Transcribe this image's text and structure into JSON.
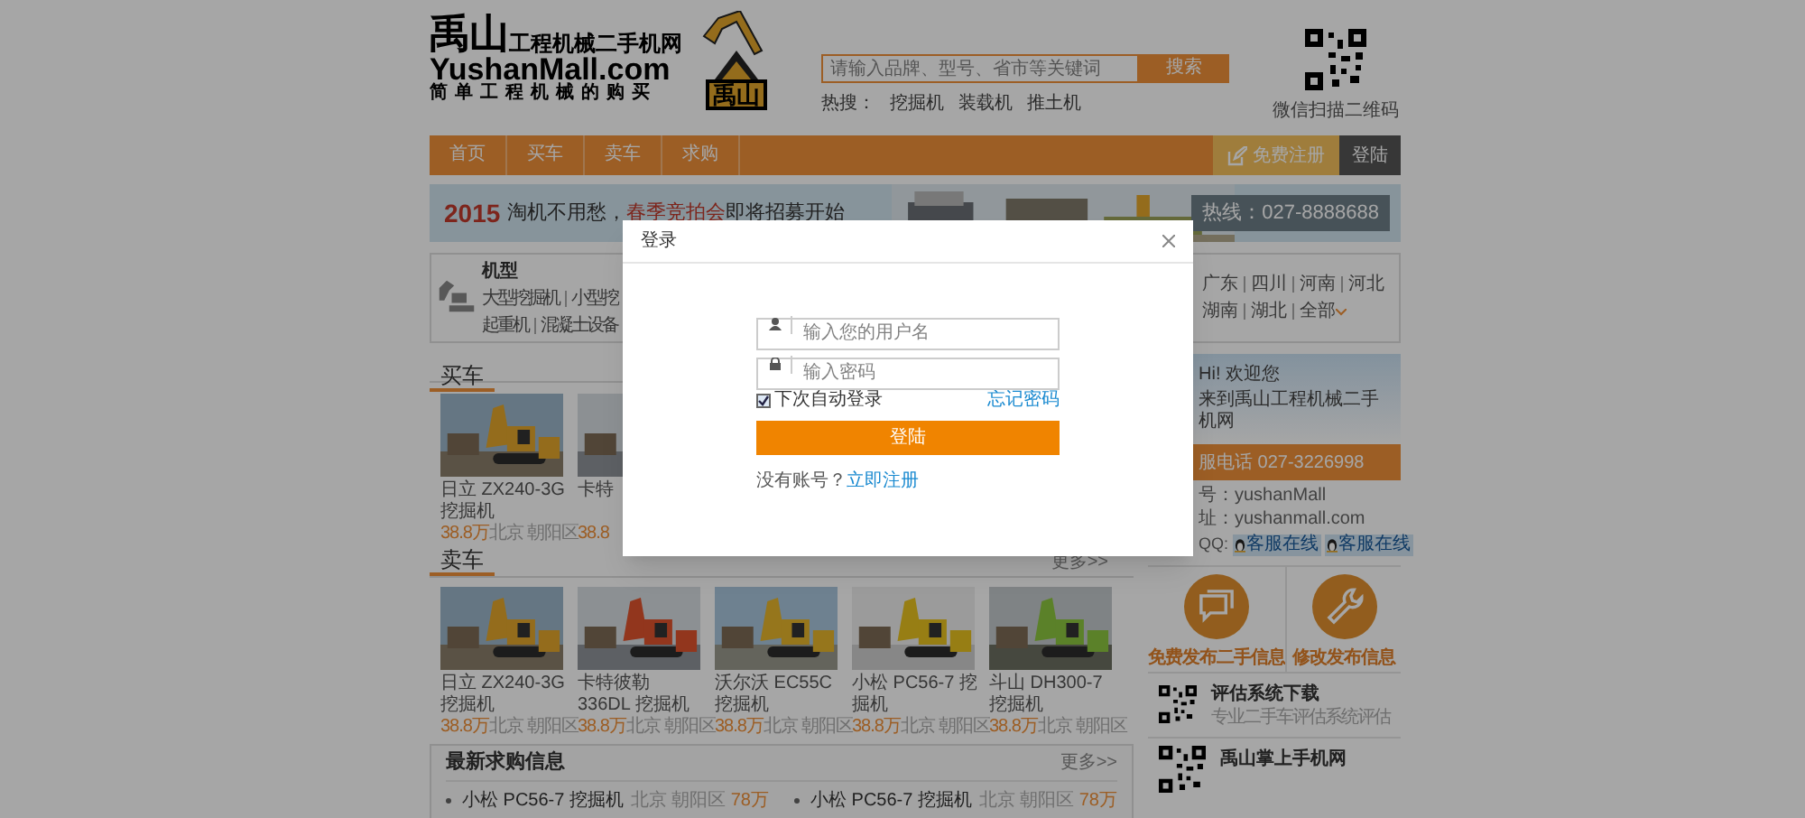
{
  "header": {
    "logo_brand": "禹山",
    "logo_name": "工程机械二手机网",
    "logo_domain": "YushanMall.com",
    "logo_slogan": "简单工程机械的购买",
    "logo_badge": "禹山",
    "search": {
      "placeholder": "请输入品牌、型号、省市等关键词",
      "button": "搜索"
    },
    "hot_label": "热搜：",
    "hot_terms": [
      "挖掘机",
      "装载机",
      "推土机"
    ],
    "qr_caption": "微信扫描二维码"
  },
  "nav": {
    "items": [
      "首页",
      "买车",
      "卖车",
      "求购"
    ],
    "register": "免费注册",
    "login": "登陆"
  },
  "banner": {
    "year": "2015",
    "text": "淘机不用愁，",
    "highlight": "春季竞拍会",
    "text_end": "即将招募开始",
    "hotline": "热线：027-8888688"
  },
  "categories": {
    "title": "机型",
    "rows": [
      [
        "大型挖掘机",
        "小型挖"
      ],
      [
        "起重机",
        "混凝土设备"
      ]
    ],
    "regions": [
      [
        "广东",
        "四川",
        "河南",
        "河北"
      ],
      [
        "湖南",
        "湖北",
        "全部"
      ]
    ]
  },
  "buy": {
    "title": "买车",
    "cards": [
      {
        "title": "日立 ZX240-3G 挖掘机",
        "price": "38.8万",
        "location": "北京 朝阳区"
      },
      {
        "title": "卡特",
        "price": "38.8"
      }
    ]
  },
  "sell": {
    "title": "卖车",
    "more": "更多>>",
    "cards": [
      {
        "title": "日立 ZX240-3G 挖掘机",
        "price": "38.8万",
        "location": "北京 朝阳区"
      },
      {
        "title": "卡特彼勒 336DL 挖掘机",
        "price": "38.8万",
        "location": "北京 朝阳区"
      },
      {
        "title": "沃尔沃 EC55C 挖掘机",
        "price": "38.8万",
        "location": "北京 朝阳区"
      },
      {
        "title": "小松 PC56-7 挖掘机",
        "price": "38.8万",
        "location": "北京 朝阳区"
      },
      {
        "title": "斗山 DH300-7 挖掘机",
        "price": "38.8万",
        "location": "北京 朝阳区"
      }
    ]
  },
  "wanted": {
    "title": "最新求购信息",
    "more": "更多>>",
    "rows": [
      {
        "title": "小松 PC56-7 挖掘机",
        "location": "北京 朝阳区",
        "price": "78万"
      },
      {
        "title": "小松 PC56-7 挖掘机",
        "location": "北京 朝阳区",
        "price": "78万"
      }
    ]
  },
  "sidebar": {
    "greeting": "Hi! 欢迎您",
    "welcome": "来到禹山工程机械二手机网",
    "phone": "服电话 027-3226998",
    "contacts": [
      "号：yushanMall",
      "址：yushanmall.com"
    ],
    "qq_label": "QQ:",
    "qq_buttons": [
      "客服在线",
      "客服在线"
    ],
    "actions": [
      "免费发布二手信息",
      "修改发布信息"
    ],
    "downloads": [
      {
        "title": "评估系统下载",
        "subtitle": "专业二手车评估系统评估"
      },
      {
        "title": "禹山掌上手机网"
      }
    ]
  },
  "login_dialog": {
    "title": "登录",
    "username": {
      "placeholder": "输入您的用户名"
    },
    "password": {
      "placeholder": "输入密码"
    },
    "remember": {
      "label": "下次自动登录",
      "checked": true
    },
    "forgot": "忘记密码",
    "submit": "登陆",
    "no_account": "没有账号？",
    "register": "立即注册"
  }
}
